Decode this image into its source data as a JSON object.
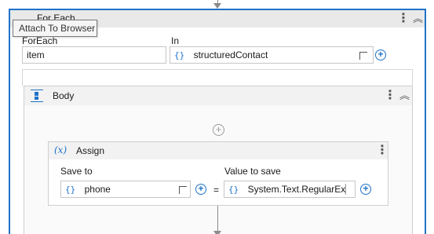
{
  "tooltip": {
    "text": "Attach To Browser"
  },
  "foreach": {
    "title": "For Each",
    "foreach_label": "ForEach",
    "foreach_value": "item",
    "in_label": "In",
    "in_value": "structuredContact",
    "in_prefix": "{}"
  },
  "body": {
    "title": "Body"
  },
  "assign": {
    "title": "Assign",
    "icon_text": "(x)",
    "save_to_label": "Save to",
    "save_to_value": "phone",
    "save_to_prefix": "{}",
    "equals": "=",
    "value_label": "Value to save",
    "value_value": "System.Text.RegularEx",
    "value_prefix": "{}"
  },
  "colors": {
    "accent": "#1f73c9",
    "header_bg": "#e9e9e9",
    "border": "#cfcfcf"
  }
}
